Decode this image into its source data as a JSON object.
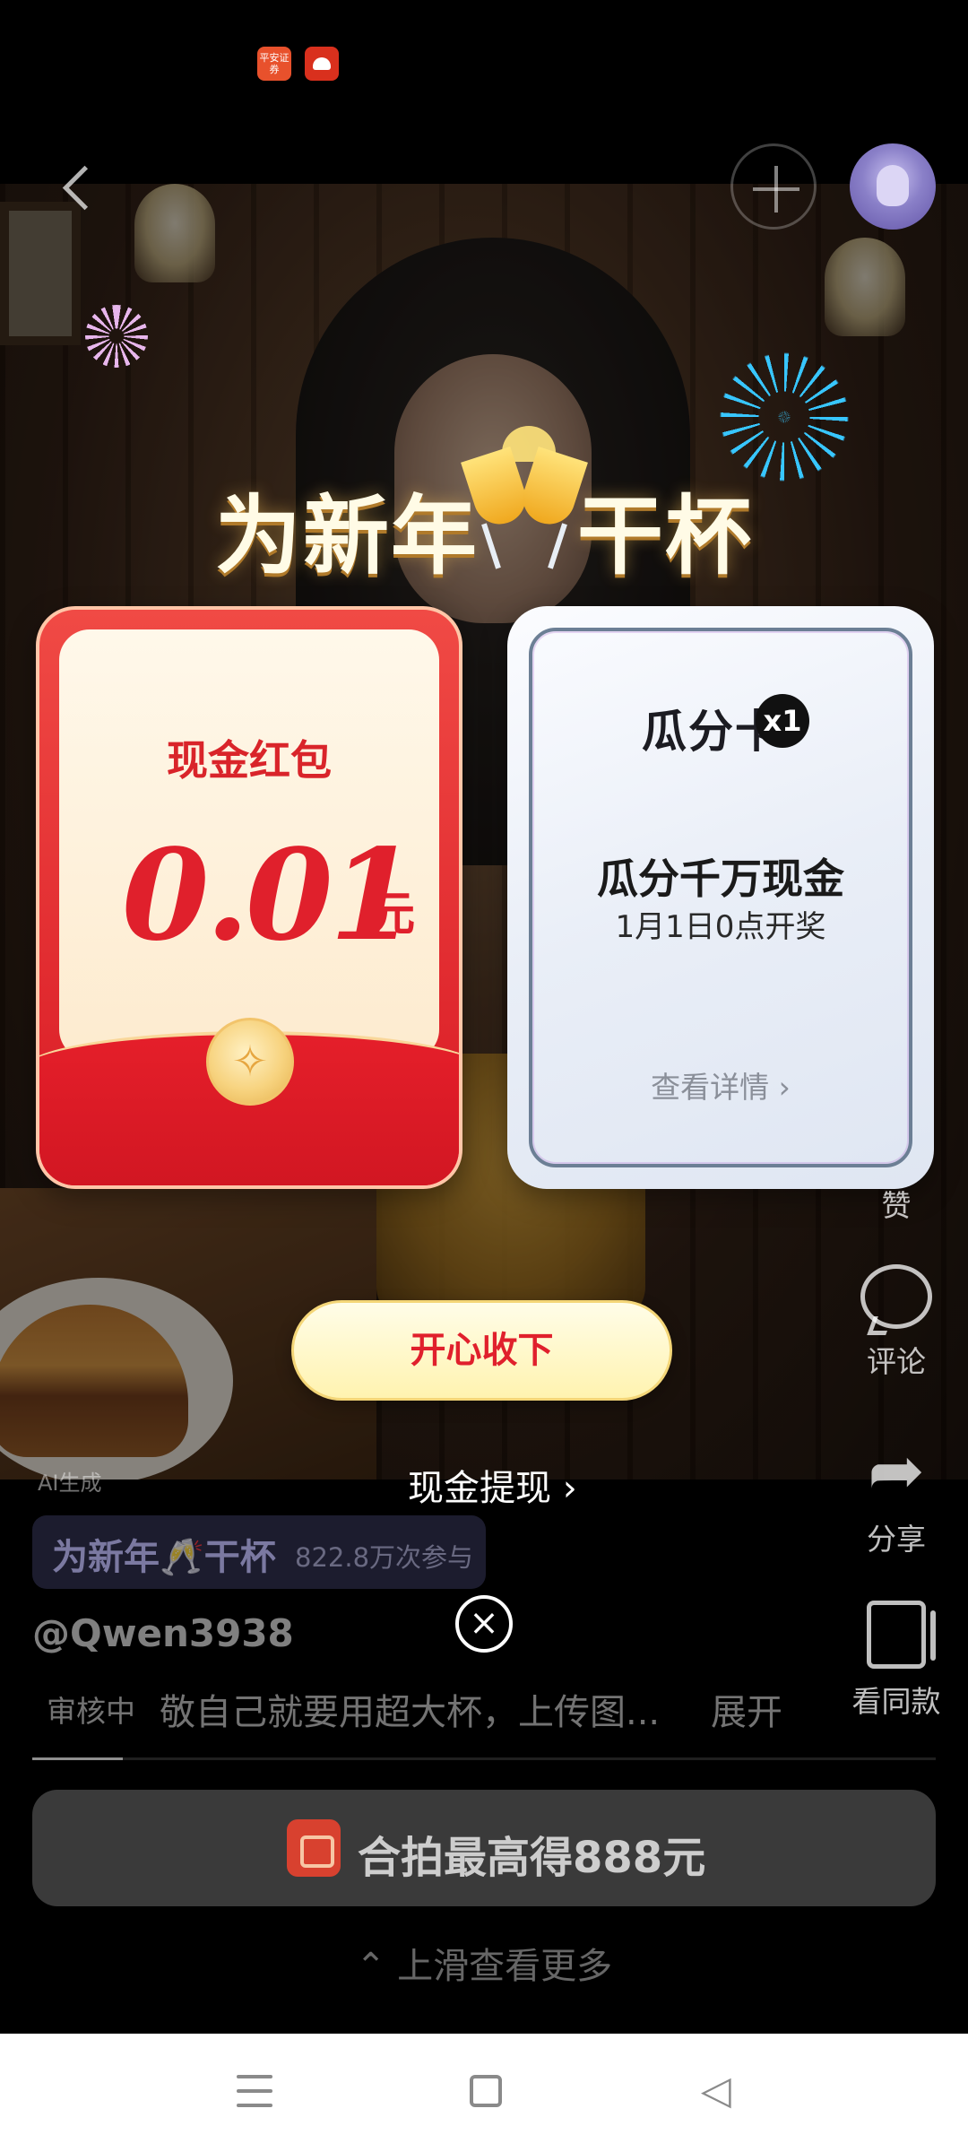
{
  "status_bar": {
    "icons": [
      {
        "name": "app-notification-icon-1",
        "text": "平安证券"
      },
      {
        "name": "app-notification-icon-2"
      }
    ]
  },
  "top_bar": {
    "back_icon": "chevron-left",
    "add_icon": "plus",
    "avatar": "user-avatar"
  },
  "popup": {
    "headline_left": "为新年",
    "headline_right": "干杯",
    "red_card": {
      "title": "现金红包",
      "amount": "0.01",
      "unit": "元"
    },
    "share_card": {
      "name": "瓜分卡",
      "count_badge": "x1",
      "title": "瓜分千万现金",
      "subtitle": "1月1日0点开奖",
      "detail_link": "查看详情 ›"
    },
    "accept_label": "开心收下",
    "withdraw_link": "现金提现  ›",
    "close_icon": "close-circle"
  },
  "right_rail": {
    "like": "赞",
    "comment": "评论",
    "share": "分享",
    "same_style": "看同款"
  },
  "video_info": {
    "ai_label": "AI生成",
    "topic_title": "为新年🥂干杯",
    "topic_count": "822.8万次参与",
    "username": "@Qwen3938",
    "review_status": "审核中",
    "caption": "敬自己就要用超大杯，上传图...",
    "expand": "展开",
    "progress": 0.1
  },
  "duet_button": {
    "label": "合拍最高得888元"
  },
  "swipe_hint": "⌃ 上滑查看更多",
  "nav_bar": {
    "menu_icon": "menu",
    "home_icon": "home",
    "back_icon": "back"
  },
  "colors": {
    "accent_red": "#e0202c",
    "accept_bg": "#fff3b0"
  }
}
